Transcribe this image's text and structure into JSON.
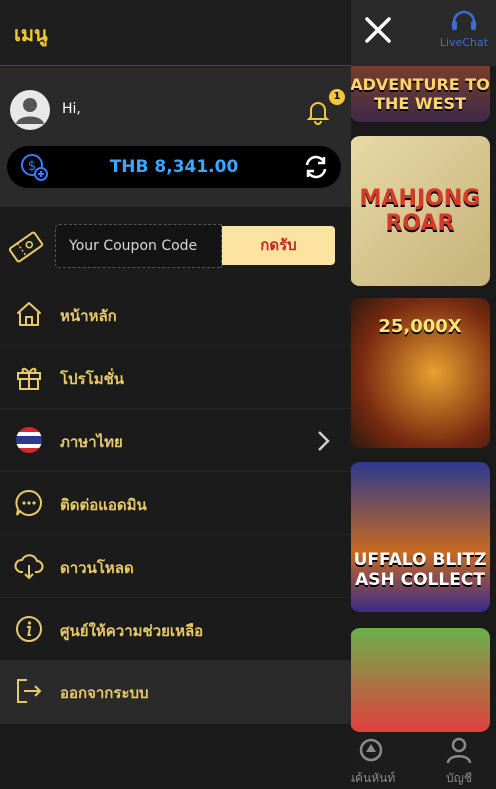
{
  "drawer": {
    "title": "เมนู",
    "greeting": "Hi,",
    "notification_count": "1",
    "balance": "THB 8,341.00"
  },
  "coupon": {
    "placeholder": "Your Coupon Code",
    "button_label": "กดรับ"
  },
  "menu": {
    "items": [
      {
        "label": "หน้าหลัก",
        "icon": "home-icon"
      },
      {
        "label": "โปรโมชั่น",
        "icon": "gift-icon"
      },
      {
        "label": "ภาษาไทย",
        "icon": "thai-flag-icon"
      },
      {
        "label": "ติดต่อแอดมิน",
        "icon": "chat-icon"
      },
      {
        "label": "ดาวนโหลด",
        "icon": "cloud-download-icon"
      },
      {
        "label": "ศูนย์ให้ความช่วยเหลือ",
        "icon": "info-icon"
      }
    ],
    "logout_label": "ออกจากระบบ"
  },
  "background": {
    "livechat_label": "LiveChat",
    "tiles": [
      {
        "title": "ADVENTURE TO THE WEST"
      },
      {
        "title": "MAHJONG ROAR"
      },
      {
        "title": "25,000X"
      },
      {
        "title": "UFFALO BLITZ ASH COLLECT"
      },
      {
        "title": ""
      }
    ],
    "bottom_nav": [
      {
        "label": "นค้นหันท์"
      },
      {
        "label": "บัญชี"
      }
    ]
  },
  "colors": {
    "accent_gold": "#f2c83a",
    "menu_text": "#e8c96a",
    "balance_blue": "#3aa6ff",
    "coupon_button_bg": "#fde3a0",
    "coupon_button_text": "#c0282a"
  }
}
